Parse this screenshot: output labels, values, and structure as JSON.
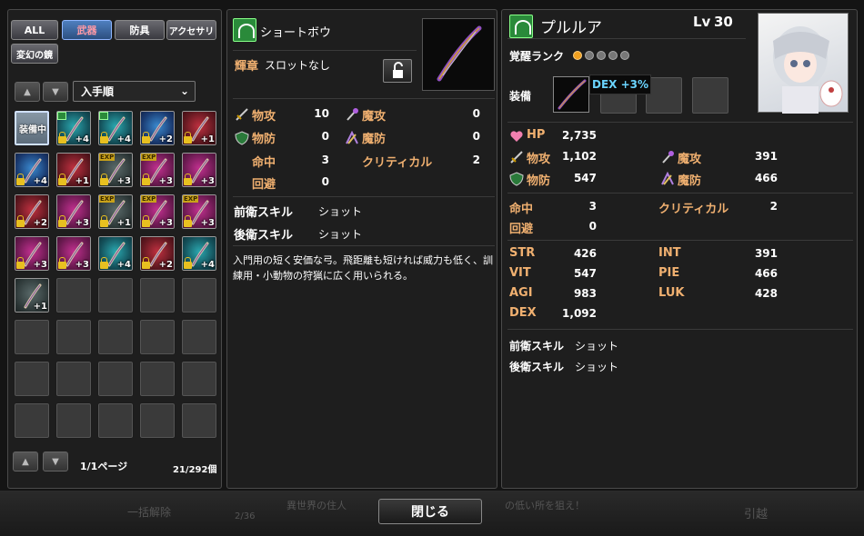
{
  "left": {
    "tabs": [
      {
        "label": "ALL",
        "active": false
      },
      {
        "label": "武器",
        "active": true
      },
      {
        "label": "防具",
        "active": false
      },
      {
        "label": "アクセサリ",
        "active": false
      },
      {
        "label": "変幻の鏡",
        "active": false
      }
    ],
    "sort": {
      "label": "入手順"
    },
    "equipped_label": "装備中",
    "items": [
      {
        "kind": "equipped",
        "plus": ""
      },
      {
        "kind": "teal",
        "plus": "+4",
        "lock": true,
        "upg": true
      },
      {
        "kind": "teal",
        "plus": "+4",
        "lock": true,
        "upg": true
      },
      {
        "kind": "blue",
        "plus": "+2",
        "lock": true
      },
      {
        "kind": "red",
        "plus": "+1",
        "lock": true
      },
      {
        "kind": "blue",
        "plus": "+4",
        "lock": true
      },
      {
        "kind": "red",
        "plus": "+1",
        "lock": true
      },
      {
        "kind": "grey",
        "plus": "+3",
        "lock": true,
        "exp": true
      },
      {
        "kind": "item",
        "plus": "+3",
        "lock": true,
        "exp": true
      },
      {
        "kind": "item",
        "plus": "+3",
        "lock": true
      },
      {
        "kind": "red",
        "plus": "+2",
        "lock": true
      },
      {
        "kind": "item",
        "plus": "+3",
        "lock": true
      },
      {
        "kind": "grey",
        "plus": "+1",
        "lock": true,
        "exp": true
      },
      {
        "kind": "item",
        "plus": "+3",
        "lock": true,
        "exp": true
      },
      {
        "kind": "item",
        "plus": "+3",
        "lock": true,
        "exp": true
      },
      {
        "kind": "item",
        "plus": "+3",
        "lock": true
      },
      {
        "kind": "item",
        "plus": "+3",
        "lock": true
      },
      {
        "kind": "teal",
        "plus": "+4",
        "lock": true
      },
      {
        "kind": "red",
        "plus": "+2",
        "lock": true
      },
      {
        "kind": "teal",
        "plus": "+4",
        "lock": true
      },
      {
        "kind": "grey",
        "plus": "+1",
        "lock": false
      }
    ],
    "page": "1/1ページ",
    "count": "21/292個"
  },
  "detail": {
    "name": "ショートボウ",
    "emblem_label": "輝章",
    "emblem_value": "スロットなし",
    "stats_left": [
      {
        "label": "物攻",
        "value": "10"
      },
      {
        "label": "物防",
        "value": "0"
      },
      {
        "label": "命中",
        "value": "3"
      },
      {
        "label": "回避",
        "value": "0"
      }
    ],
    "stats_right": [
      {
        "label": "魔攻",
        "value": "0"
      },
      {
        "label": "魔防",
        "value": "0"
      },
      {
        "label": "クリティカル",
        "value": "2"
      }
    ],
    "front_skill_label": "前衛スキル",
    "front_skill": "ショット",
    "back_skill_label": "後衛スキル",
    "back_skill": "ショット",
    "description": "入門用の短く安価な弓。飛距離も短ければ威力も低く、訓練用・小動物の狩猟に広く用いられる。"
  },
  "char": {
    "name": "プルルア",
    "lv_label": "Lv",
    "lv": "30",
    "awaken_label": "覚醒ランク",
    "equip_label": "装備",
    "tooltip": "DEX +3%",
    "hp_label": "HP",
    "hp": "2,735",
    "stats_left": [
      {
        "label": "物攻",
        "value": "1,102"
      },
      {
        "label": "物防",
        "value": "547"
      }
    ],
    "stats_right": [
      {
        "label": "魔攻",
        "value": "391"
      },
      {
        "label": "魔防",
        "value": "466"
      }
    ],
    "hit_label": "命中",
    "hit": "3",
    "crit_label": "クリティカル",
    "crit": "2",
    "eva_label": "回避",
    "eva": "0",
    "attrs_left": [
      {
        "label": "STR",
        "value": "426"
      },
      {
        "label": "VIT",
        "value": "547"
      },
      {
        "label": "AGI",
        "value": "983"
      },
      {
        "label": "DEX",
        "value": "1,092"
      }
    ],
    "attrs_right": [
      {
        "label": "INT",
        "value": "391"
      },
      {
        "label": "PIE",
        "value": "466"
      },
      {
        "label": "LUK",
        "value": "428"
      }
    ],
    "front_skill_label": "前衛スキル",
    "front_skill": "ショット",
    "back_skill_label": "後衛スキル",
    "back_skill": "ショット"
  },
  "close_label": "閉じる",
  "background": {
    "bulk_release": "一括解除",
    "page": "2/36",
    "text1": "異世界の住人",
    "text2": "の低い所を狙え！",
    "btn1": "",
    "btn2": "引越",
    "btn3": ""
  }
}
